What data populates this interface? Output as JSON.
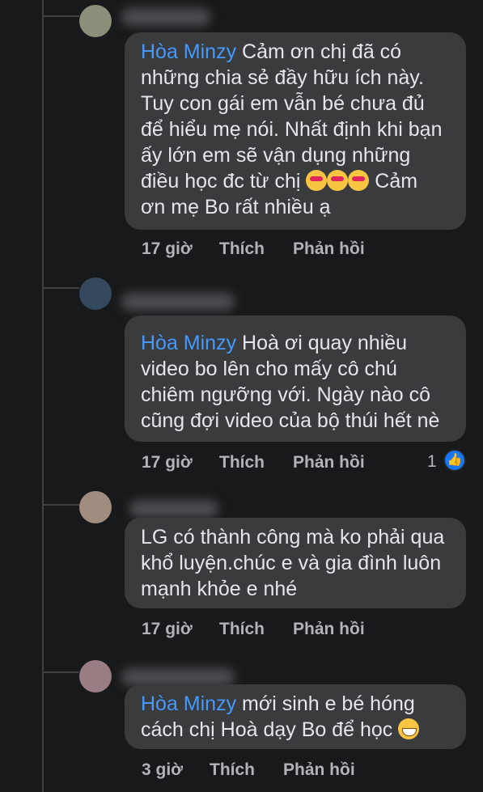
{
  "comments": [
    {
      "mention": "Hòa Minzy",
      "text_l1": " Cảm ơn chị đã có",
      "text_rest": "những chia sẻ đầy hữu ích này.\nTuy con gái em vẫn bé chưa đủ\nđể hiểu mẹ nói. Nhất định khi bạn\nấy lớn em sẽ vận dụng những\nđiều học đc từ chị",
      "text_after_emoji": " Cảm\nơn mẹ Bo rất nhiều ạ",
      "time": "17 giờ",
      "like": "Thích",
      "reply": "Phản hồi"
    },
    {
      "mention": "Hòa Minzy",
      "text_l1": " Hoà ơi quay nhiều",
      "text_rest": "video bo lên cho mấy cô chú\nchiêm ngưỡng với.  Ngày nào cô\ncũng đợi video của bộ thúi hết nè",
      "time": "17 giờ",
      "like": "Thích",
      "reply": "Phản hồi",
      "reaction_count": "1",
      "reaction_icon": "thumbs-up-icon"
    },
    {
      "text": "LG có thành công mà ko phải qua\nkhổ luyện.chúc e và gia đình  luôn\nmạnh khỏe e nhé",
      "time": "17 giờ",
      "like": "Thích",
      "reply": "Phản hồi"
    },
    {
      "mention": "Hòa Minzy",
      "text_l1": " mới sinh e bé hóng",
      "text_rest": "cách chị Hoà dạy Bo để học",
      "time": "3 giờ",
      "like": "Thích",
      "reply": "Phản hồi"
    }
  ],
  "colors": {
    "background": "#18191a",
    "bubble": "#3a3b3c",
    "mention": "#4599ff",
    "text": "#e4e6eb",
    "muted": "#b0b3b8",
    "like_blue": "#1877f2"
  }
}
